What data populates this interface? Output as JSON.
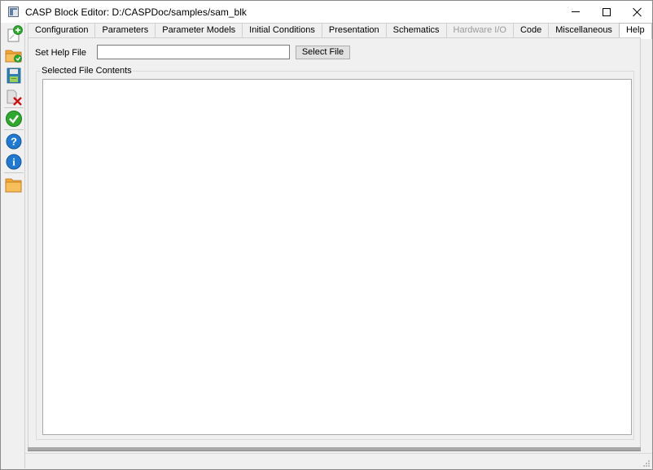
{
  "window": {
    "title": "CASP Block Editor: D:/CASPDoc/samples/sam_blk"
  },
  "toolbar": {
    "tools": [
      {
        "name": "new-block",
        "icon": "new-document-plus-icon"
      },
      {
        "name": "open",
        "icon": "folder-open-icon"
      },
      {
        "name": "save",
        "icon": "save-disk-icon"
      },
      {
        "name": "close",
        "icon": "document-delete-icon"
      },
      {
        "name": "verify",
        "icon": "green-checkmark-icon"
      },
      {
        "name": "help",
        "icon": "question-icon"
      },
      {
        "name": "about",
        "icon": "info-icon"
      },
      {
        "name": "folder",
        "icon": "folder-icon"
      }
    ]
  },
  "tabs": [
    {
      "label": "Configuration",
      "state": "normal"
    },
    {
      "label": "Parameters",
      "state": "normal"
    },
    {
      "label": "Parameter Models",
      "state": "normal"
    },
    {
      "label": "Initial Conditions",
      "state": "normal"
    },
    {
      "label": "Presentation",
      "state": "normal"
    },
    {
      "label": "Schematics",
      "state": "normal"
    },
    {
      "label": "Hardware I/O",
      "state": "disabled"
    },
    {
      "label": "Code",
      "state": "normal"
    },
    {
      "label": "Miscellaneous",
      "state": "normal"
    },
    {
      "label": "Help",
      "state": "active"
    }
  ],
  "help_panel": {
    "set_help_file_label": "Set Help File",
    "help_file_value": "",
    "select_file_label": "Select File",
    "selected_file_contents_label": "Selected File Contents",
    "contents_text": ""
  },
  "colors": {
    "check_green": "#2fa82f",
    "help_blue": "#1f78d1",
    "folder_orange": "#f2a93b",
    "delete_red": "#d01010"
  }
}
